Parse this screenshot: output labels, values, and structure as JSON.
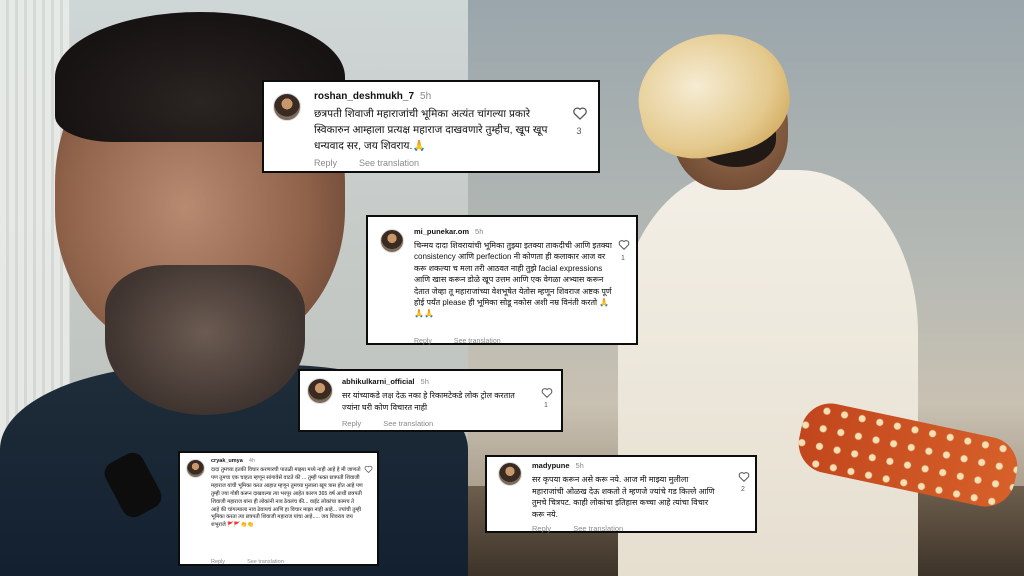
{
  "photos": {
    "left": "left-photo",
    "right": "right-photo"
  },
  "comments": [
    {
      "username": "roshan_deshmukh_7",
      "time": "5h",
      "text": "छत्रपती शिवाजी महाराजांची भूमिका अत्यंत चांगल्या प्रकारे स्विकारुन आम्हाला प्रत्यक्ष महाराज दाखवणारे तुम्हीच, खूप खूप धन्यवाद सर, जय शिवराय.🙏",
      "likes": "3",
      "reply": "Reply",
      "see_translation": "See translation"
    },
    {
      "username": "mi_punekar.om",
      "time": "5h",
      "text": "चिन्मय दादा शिवरायांची भूमिका तुझ्या इतक्या ताकदीची आणि इतक्या consistency आणि perfection नी कोणता ही कलाकार आज वर करू शकल्या च मला तरी आठवत नाही तुझे facial expressions आणि खास करून डोळे खूप उत्तम आणि एक वेगळा अभ्यास करून देतात जेव्हा तू महाराजांच्या वेशभूषेत येतोस म्हणून शिवराज अष्टक पूर्ण होई पर्यंत please ही भूमिका सोडू नकोस अशी नम्र विनंती करतो 🙏🙏🙏",
      "likes": "1",
      "reply": "Reply",
      "see_translation": "See translation"
    },
    {
      "username": "abhikulkarni_official",
      "time": "5h",
      "text": "सर यांच्याकडे लक्ष देऊ नका हे रिकामटेकडे लोक ट्रोल करतात ज्यांना घरी कोण विचारत नाही",
      "likes": "1",
      "reply": "Reply",
      "see_translation": "See translation"
    },
    {
      "username": "cryak_umya",
      "time": "4h",
      "text": "दादा तुमच्या इतकी विचार करणारची पातळी माझ्या मध्ये नाही आहे हे मी जाणतो पण तुमचा एक चाहता म्हणून सांगावेसे वाटते की ... तुम्ही फक्त छत्रपती शिवाजी महाराज यांची भूमिका करत आहात म्हणून तुमच्या मुलाला खूप त्रास होत आहे पण तुम्ही ज्या गोष्टी करून दाखवल्या त्या भरपूर आहेत कारण 365 वर्ष आधी छत्रपती शिवाजी महाराज यांना ही लोकांनी नाव ठेवलंच की... वाईट लोकांचा कामच ते आहे की चांगल्याला नाव ठेवायचं आणि हा विचार माझा नाही आहे... ज्यांची तुम्ही भूमिका करता त्या छत्रपती शिवाजी महाराज यांचा आहे..... जय शिवराय जय शंभुराजे 🚩🚩👏👏",
      "likes": "",
      "reply": "Reply",
      "see_translation": "See translation"
    },
    {
      "username": "madypune",
      "time": "5h",
      "text": "सर कृपया करून असे करू नये. आज मी माझ्या मुलीला महाराजांची ओळख देऊ शकतो ते म्हणजे ज्यांचे गड किल्ले आणि तुमचे चित्रपट. काही लोकांचा इतिहास कच्चा आहे त्यांचा विचार करू नये.",
      "likes": "2",
      "reply": "Reply",
      "see_translation": "See translation"
    }
  ],
  "icons": {
    "heart": "heart-outline-icon"
  }
}
